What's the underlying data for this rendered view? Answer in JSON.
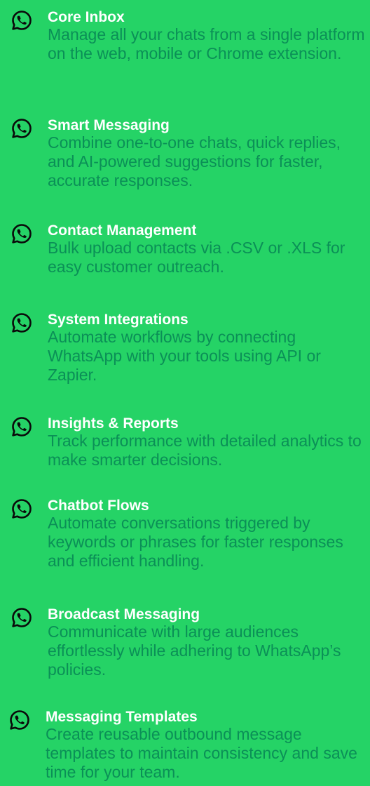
{
  "colors": {
    "background": "#25D366",
    "title": "#ffffff",
    "description": "#0b8f57",
    "icon": "#0a0a0a"
  },
  "features": [
    {
      "icon": "whatsapp-icon",
      "title": "Core Inbox",
      "description": "Manage all your chats from a single platform on the web, mobile or Chrome extension."
    },
    {
      "icon": "whatsapp-icon",
      "title": "Smart Messaging",
      "description": "Combine one-to-one chats, quick replies, and AI-powered suggestions for faster, accurate responses."
    },
    {
      "icon": "whatsapp-icon",
      "title": "Contact Management",
      "description": "Bulk upload contacts via .CSV or .XLS for easy customer outreach."
    },
    {
      "icon": "whatsapp-icon",
      "title": "System Integrations",
      "description": "Automate workflows by connecting WhatsApp with your tools using API or Zapier."
    },
    {
      "icon": "whatsapp-icon",
      "title": "Insights & Reports",
      "description": "Track performance with detailed analytics to make smarter decisions."
    },
    {
      "icon": "whatsapp-icon",
      "title": "Chatbot Flows",
      "description": "Automate conversations triggered by keywords or phrases for faster responses and efficient handling."
    },
    {
      "icon": "whatsapp-icon",
      "title": "Broadcast Messaging",
      "description": "Communicate with large audiences effortlessly while adhering to WhatsApp’s policies."
    },
    {
      "icon": "whatsapp-icon",
      "title": "Messaging Templates",
      "description": "Create reusable outbound message templates to maintain consistency and save time for your team."
    }
  ]
}
